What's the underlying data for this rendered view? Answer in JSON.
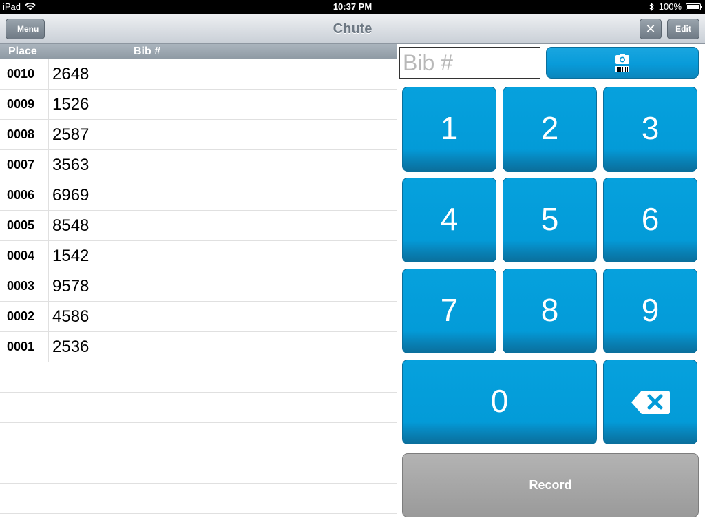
{
  "status": {
    "device": "iPad",
    "time": "10:37 PM",
    "battery": "100%"
  },
  "nav": {
    "back_label": "Menu",
    "title": "Chute",
    "close_symbol": "✕",
    "edit_label": "Edit"
  },
  "table": {
    "header_place": "Place",
    "header_bib": "Bib #",
    "rows": [
      {
        "place": "0010",
        "bib": "2648"
      },
      {
        "place": "0009",
        "bib": "1526"
      },
      {
        "place": "0008",
        "bib": "2587"
      },
      {
        "place": "0007",
        "bib": "3563"
      },
      {
        "place": "0006",
        "bib": "6969"
      },
      {
        "place": "0005",
        "bib": "8548"
      },
      {
        "place": "0004",
        "bib": "1542"
      },
      {
        "place": "0003",
        "bib": "9578"
      },
      {
        "place": "0002",
        "bib": "4586"
      },
      {
        "place": "0001",
        "bib": "2536"
      }
    ]
  },
  "entry": {
    "placeholder": "Bib #",
    "value": "",
    "scan_icon": "camera-barcode-icon"
  },
  "keypad": {
    "keys": [
      "1",
      "2",
      "3",
      "4",
      "5",
      "6",
      "7",
      "8",
      "9",
      "0"
    ],
    "delete_icon": "backspace-icon"
  },
  "record_label": "Record",
  "colors": {
    "key_blue": "#039bd8",
    "record_gray": "#a8a8a8"
  }
}
